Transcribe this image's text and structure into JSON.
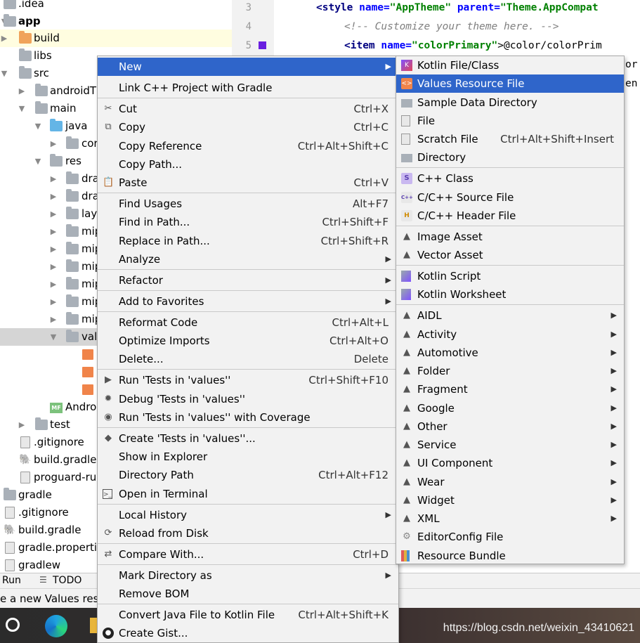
{
  "tree": {
    "rows": [
      {
        "label": ".idea",
        "arrow": "",
        "icon": "folder"
      },
      {
        "label": "app",
        "arrow": "▼",
        "icon": "module-folder"
      },
      {
        "label": "build",
        "arrow": "▶",
        "icon": "folder-orange"
      },
      {
        "label": "libs",
        "arrow": "",
        "icon": "folder"
      },
      {
        "label": "src",
        "arrow": "▼",
        "icon": "folder"
      },
      {
        "label": "androidT",
        "arrow": "▶",
        "icon": "folder"
      },
      {
        "label": "main",
        "arrow": "▼",
        "icon": "folder"
      },
      {
        "label": "java",
        "arrow": "▼",
        "icon": "folder-blue"
      },
      {
        "label": "cor",
        "arrow": "▶",
        "icon": "package"
      },
      {
        "label": "res",
        "arrow": "▼",
        "icon": "folder"
      },
      {
        "label": "dra",
        "arrow": "▶",
        "icon": "folder"
      },
      {
        "label": "dra",
        "arrow": "▶",
        "icon": "folder"
      },
      {
        "label": "layo",
        "arrow": "▶",
        "icon": "folder"
      },
      {
        "label": "mip",
        "arrow": "▶",
        "icon": "folder"
      },
      {
        "label": "mip",
        "arrow": "▶",
        "icon": "folder"
      },
      {
        "label": "mip",
        "arrow": "▶",
        "icon": "folder"
      },
      {
        "label": "mip",
        "arrow": "▶",
        "icon": "folder"
      },
      {
        "label": "mip",
        "arrow": "▶",
        "icon": "folder"
      },
      {
        "label": "mip",
        "arrow": "▶",
        "icon": "folder"
      },
      {
        "label": "valu",
        "arrow": "▼",
        "icon": "folder"
      },
      {
        "label": "",
        "arrow": "",
        "icon": "xml"
      },
      {
        "label": "",
        "arrow": "",
        "icon": "xml"
      },
      {
        "label": "",
        "arrow": "",
        "icon": "xml"
      },
      {
        "label": "Andro",
        "arrow": "",
        "icon": "manifest"
      },
      {
        "label": "test",
        "arrow": "▶",
        "icon": "folder"
      },
      {
        "label": ".gitignore",
        "arrow": "",
        "icon": "file"
      },
      {
        "label": "build.gradle",
        "arrow": "",
        "icon": "gradle"
      },
      {
        "label": "proguard-ru",
        "arrow": "",
        "icon": "file"
      },
      {
        "label": "gradle",
        "arrow": "",
        "icon": "folder"
      },
      {
        "label": ".gitignore",
        "arrow": "",
        "icon": "file"
      },
      {
        "label": "build.gradle",
        "arrow": "",
        "icon": "gradle"
      },
      {
        "label": "gradle.properti",
        "arrow": "",
        "icon": "properties"
      },
      {
        "label": "gradlew",
        "arrow": "",
        "icon": "file"
      }
    ]
  },
  "editor": {
    "line_numbers": [
      "3",
      "4",
      "5"
    ],
    "line3": {
      "open": "<",
      "tag": "style",
      "a1": " name=",
      "v1": "\"AppTheme\"",
      "a2": " parent=",
      "v2": "\"Theme.AppCompat"
    },
    "line4": "<!-- Customize your theme here. -->",
    "line5": {
      "open": "<",
      "tag": "item",
      "a1": " name=",
      "v1": "\"colorPrimary\"",
      "rest": ">@color/colorPrim"
    },
    "line6_tail": "or",
    "line7_tail": "en",
    "color_marker": "#6a1fe0"
  },
  "toolbar_strip": {
    "run": "Run",
    "todo": "TODO"
  },
  "status_text": "e a new Values reso",
  "watermark": "https://blog.csdn.net/weixin_43410621",
  "context_menu": {
    "items": [
      {
        "label": "New",
        "shortcut": "",
        "submenu": true,
        "icon": ""
      },
      {
        "label": "Link C++ Project with Gradle",
        "shortcut": "",
        "icon": ""
      },
      {
        "label": "Cut",
        "shortcut": "Ctrl+X",
        "icon": "scissors-icon"
      },
      {
        "label": "Copy",
        "shortcut": "Ctrl+C",
        "icon": "copy-icon"
      },
      {
        "label": "Copy Reference",
        "shortcut": "Ctrl+Alt+Shift+C",
        "icon": ""
      },
      {
        "label": "Copy Path...",
        "shortcut": "",
        "icon": ""
      },
      {
        "label": "Paste",
        "shortcut": "Ctrl+V",
        "icon": "paste-icon"
      },
      {
        "label": "Find Usages",
        "shortcut": "Alt+F7",
        "icon": ""
      },
      {
        "label": "Find in Path...",
        "shortcut": "Ctrl+Shift+F",
        "icon": ""
      },
      {
        "label": "Replace in Path...",
        "shortcut": "Ctrl+Shift+R",
        "icon": ""
      },
      {
        "label": "Analyze",
        "shortcut": "",
        "submenu": true,
        "icon": ""
      },
      {
        "label": "Refactor",
        "shortcut": "",
        "submenu": true,
        "icon": ""
      },
      {
        "label": "Add to Favorites",
        "shortcut": "",
        "submenu": true,
        "icon": ""
      },
      {
        "label": "Reformat Code",
        "shortcut": "Ctrl+Alt+L",
        "icon": ""
      },
      {
        "label": "Optimize Imports",
        "shortcut": "Ctrl+Alt+O",
        "icon": ""
      },
      {
        "label": "Delete...",
        "shortcut": "Delete",
        "icon": ""
      },
      {
        "label": "Run 'Tests in 'values''",
        "shortcut": "Ctrl+Shift+F10",
        "icon": "run-icon"
      },
      {
        "label": "Debug 'Tests in 'values''",
        "shortcut": "",
        "icon": "debug-icon"
      },
      {
        "label": "Run 'Tests in 'values'' with Coverage",
        "shortcut": "",
        "icon": "coverage-icon"
      },
      {
        "label": "Create 'Tests in 'values''...",
        "shortcut": "",
        "icon": "create-config-icon"
      },
      {
        "label": "Show in Explorer",
        "shortcut": "",
        "icon": ""
      },
      {
        "label": "Directory Path",
        "shortcut": "Ctrl+Alt+F12",
        "icon": ""
      },
      {
        "label": "Open in Terminal",
        "shortcut": "",
        "icon": "terminal-icon"
      },
      {
        "label": "Local History",
        "shortcut": "",
        "submenu": true,
        "icon": ""
      },
      {
        "label": "Reload from Disk",
        "shortcut": "",
        "icon": "reload-icon"
      },
      {
        "label": "Compare With...",
        "shortcut": "Ctrl+D",
        "icon": "compare-icon"
      },
      {
        "label": "Mark Directory as",
        "shortcut": "",
        "submenu": true,
        "icon": ""
      },
      {
        "label": "Remove BOM",
        "shortcut": "",
        "icon": ""
      },
      {
        "label": "Convert Java File to Kotlin File",
        "shortcut": "Ctrl+Alt+Shift+K",
        "icon": ""
      },
      {
        "label": "Create Gist...",
        "shortcut": "",
        "icon": "github-icon"
      }
    ]
  },
  "submenu": {
    "items": [
      {
        "label": "Kotlin File/Class",
        "shortcut": "",
        "icon": "kotlin-file-icon"
      },
      {
        "label": "Values Resource File",
        "shortcut": "",
        "icon": "values-resource-icon"
      },
      {
        "label": "Sample Data Directory",
        "shortcut": "",
        "icon": "folder-icon"
      },
      {
        "label": "File",
        "shortcut": "",
        "icon": "file-icon"
      },
      {
        "label": "Scratch File",
        "shortcut": "Ctrl+Alt+Shift+Insert",
        "icon": "scratch-file-icon"
      },
      {
        "label": "Directory",
        "shortcut": "",
        "icon": "folder-icon"
      },
      {
        "label": "C++ Class",
        "shortcut": "",
        "icon": "cpp-class-icon"
      },
      {
        "label": "C/C++ Source File",
        "shortcut": "",
        "icon": "cpp-source-icon"
      },
      {
        "label": "C/C++ Header File",
        "shortcut": "",
        "icon": "cpp-header-icon"
      },
      {
        "label": "Image Asset",
        "shortcut": "",
        "icon": "android-icon"
      },
      {
        "label": "Vector Asset",
        "shortcut": "",
        "icon": "android-icon"
      },
      {
        "label": "Kotlin Script",
        "shortcut": "",
        "icon": "kotlin-script-icon"
      },
      {
        "label": "Kotlin Worksheet",
        "shortcut": "",
        "icon": "kotlin-worksheet-icon"
      },
      {
        "label": "AIDL",
        "shortcut": "",
        "submenu": true,
        "icon": "android-icon"
      },
      {
        "label": "Activity",
        "shortcut": "",
        "submenu": true,
        "icon": "android-icon"
      },
      {
        "label": "Automotive",
        "shortcut": "",
        "submenu": true,
        "icon": "android-icon"
      },
      {
        "label": "Folder",
        "shortcut": "",
        "submenu": true,
        "icon": "android-icon"
      },
      {
        "label": "Fragment",
        "shortcut": "",
        "submenu": true,
        "icon": "android-icon"
      },
      {
        "label": "Google",
        "shortcut": "",
        "submenu": true,
        "icon": "android-icon"
      },
      {
        "label": "Other",
        "shortcut": "",
        "submenu": true,
        "icon": "android-icon"
      },
      {
        "label": "Service",
        "shortcut": "",
        "submenu": true,
        "icon": "android-icon"
      },
      {
        "label": "UI Component",
        "shortcut": "",
        "submenu": true,
        "icon": "android-icon"
      },
      {
        "label": "Wear",
        "shortcut": "",
        "submenu": true,
        "icon": "android-icon"
      },
      {
        "label": "Widget",
        "shortcut": "",
        "submenu": true,
        "icon": "android-icon"
      },
      {
        "label": "XML",
        "shortcut": "",
        "submenu": true,
        "icon": "android-icon"
      },
      {
        "label": "EditorConfig File",
        "shortcut": "",
        "icon": "gear-icon"
      },
      {
        "label": "Resource Bundle",
        "shortcut": "",
        "icon": "resource-bundle-icon"
      }
    ]
  },
  "colors": {
    "selection": "#2f65ca",
    "menu_bg": "#f2f2f2",
    "android_green": "#3ddc84"
  }
}
